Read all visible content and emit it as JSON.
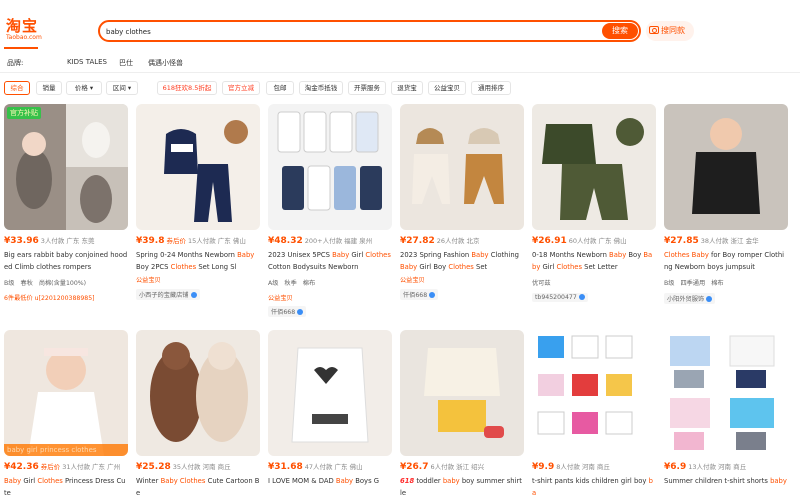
{
  "header": {
    "logo_cn": "淘宝",
    "logo_en": "Taobao.com",
    "search_value": "baby clothes",
    "search_button": "搜索",
    "photo_search": "搜同款"
  },
  "brand_row": {
    "label": "品牌:",
    "items": [
      "KIDS TALES",
      "巴仕",
      "偶遇小怪兽"
    ]
  },
  "filters": [
    {
      "label": "综合",
      "active": true
    },
    {
      "label": "销量"
    },
    {
      "label": "价格 ▾"
    },
    {
      "label": "区间 ▾"
    },
    {
      "label": "618狂欢8.5折起",
      "red": true
    },
    {
      "label": "官方立减",
      "red": true
    },
    {
      "label": "包邮"
    },
    {
      "label": "淘金币抵钱"
    },
    {
      "label": "开票服务"
    },
    {
      "label": "退货宝"
    },
    {
      "label": "公益宝贝"
    },
    {
      "label": "通用排序"
    }
  ],
  "products": [
    {
      "price": "¥33.96",
      "sales": "3人付款",
      "loc": "广东 东莞",
      "title_html": "Big ears rabbit baby conjoined hooded Climb clothes rompers",
      "meta": [
        "B级",
        "春秋",
        "尚棉(含量100%)"
      ],
      "tag": "6件最低价 u[2201200388985]",
      "badge": "官方补贴"
    },
    {
      "price": "¥39.8",
      "price_suffix": "券后价",
      "sales": "15人付款",
      "loc": "广东 佛山",
      "title_parts": [
        "Spring 0-24 Months Newborn ",
        "Baby",
        " Boy 2PCS ",
        "Clothes",
        " Set Long Sl"
      ],
      "tag": "公益宝贝",
      "shop": "小西子的宝藏店铺"
    },
    {
      "price": "¥48.32",
      "sales": "200+人付款",
      "loc": "福建 泉州",
      "title_parts": [
        "2023 Unisex 5PCS ",
        "Baby",
        " Girl ",
        "Clothes",
        " Cotton Bodysuits Newborn"
      ],
      "meta": [
        "A级",
        "秋季",
        "棉布"
      ],
      "tag": "公益宝贝",
      "shop": "仟佰668"
    },
    {
      "price": "¥27.82",
      "sales": "26人付款",
      "loc": "北京",
      "title_parts": [
        "2023 Spring Fashion ",
        "Baby",
        " Clothing ",
        "Baby",
        " Girl Boy ",
        "Clothes",
        " Set"
      ],
      "tag": "公益宝贝",
      "shop": "仟佰668"
    },
    {
      "price": "¥26.91",
      "sales": "60人付款",
      "loc": "广东 佛山",
      "title_parts": [
        "0-18 Months Newborn ",
        "Baby",
        " Boy ",
        "Baby",
        " Girl ",
        "Clothes",
        " Set Letter"
      ],
      "meta": [
        "优可兹"
      ],
      "shop": "tb945200477"
    },
    {
      "price": "¥27.85",
      "sales": "38人付款",
      "loc": "浙江 金华",
      "title_parts": [
        "Clothes",
        " ",
        "Baby",
        " for Boy romper Clothing Newborn boys jumpsuit"
      ],
      "meta": [
        "B级",
        "四季通用",
        "棉布"
      ],
      "shop": "小阳外贸服饰"
    },
    {
      "price": "¥42.36",
      "price_suffix": "券后价",
      "sales": "31人付款",
      "loc": "广东 广州",
      "title_parts": [
        "Baby",
        " Girl ",
        "Clothes",
        " Princess Dress Cute"
      ],
      "badge_bottom": "baby girl princess clothes"
    },
    {
      "price": "¥25.28",
      "sales": "35人付款",
      "loc": "河南 商丘",
      "title_parts": [
        "Winter ",
        "Baby",
        " ",
        "Clothes",
        " Cute Cartoon Be"
      ]
    },
    {
      "price": "¥31.68",
      "sales": "47人付款",
      "loc": "广东 佛山",
      "title_parts": [
        "I LOVE MOM & DAD ",
        "Baby",
        " Boys G"
      ]
    },
    {
      "price": "¥26.7",
      "sales": "6人付款",
      "loc": "浙江 绍兴",
      "title_parts": [
        "618",
        " toddler ",
        "baby",
        " boy summer shirt le"
      ]
    },
    {
      "price": "¥9.9",
      "sales": "8人付款",
      "loc": "河南 商丘",
      "title_parts": [
        "t-shirt pants kids children girl boy ",
        "ba"
      ]
    },
    {
      "price": "¥6.9",
      "sales": "13人付款",
      "loc": "河南 商丘",
      "title_parts": [
        "Summer children t-shirt shorts ",
        "baby"
      ]
    }
  ]
}
